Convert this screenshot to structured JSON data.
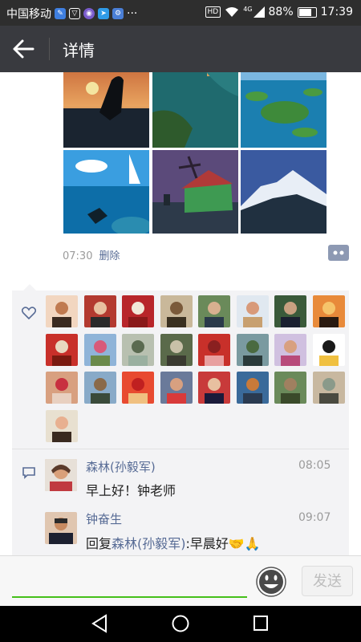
{
  "status_bar": {
    "carrier": "中国移动",
    "network": "4G",
    "hd": "HD",
    "battery": "88%",
    "battery_level": 0.88,
    "time": "17:39",
    "more": "···"
  },
  "header": {
    "title": "详情",
    "back_icon": "back-arrow-icon"
  },
  "post": {
    "time": "07:30",
    "delete_label": "删除",
    "photos": [
      "heron-sunset",
      "aerial-lake",
      "islands-lake",
      "underwater-diver",
      "windmill",
      "snow-mountain"
    ]
  },
  "likes": {
    "icon": "heart-icon",
    "count": 25
  },
  "comments": [
    {
      "name": "森林(孙毅军)",
      "time": "08:05",
      "text": "早上好！钟老师"
    },
    {
      "name": "钟奋生",
      "time": "09:07",
      "text_prefix": "回复",
      "reply_to": "森林(孙毅军)",
      "text_suffix": ":早晨好🤝🙏"
    }
  ],
  "input": {
    "placeholder": "",
    "send_label": "发送"
  },
  "colors": {
    "link": "#576b95",
    "titlebar": "#393a3f",
    "accent_green": "#45c01a"
  }
}
